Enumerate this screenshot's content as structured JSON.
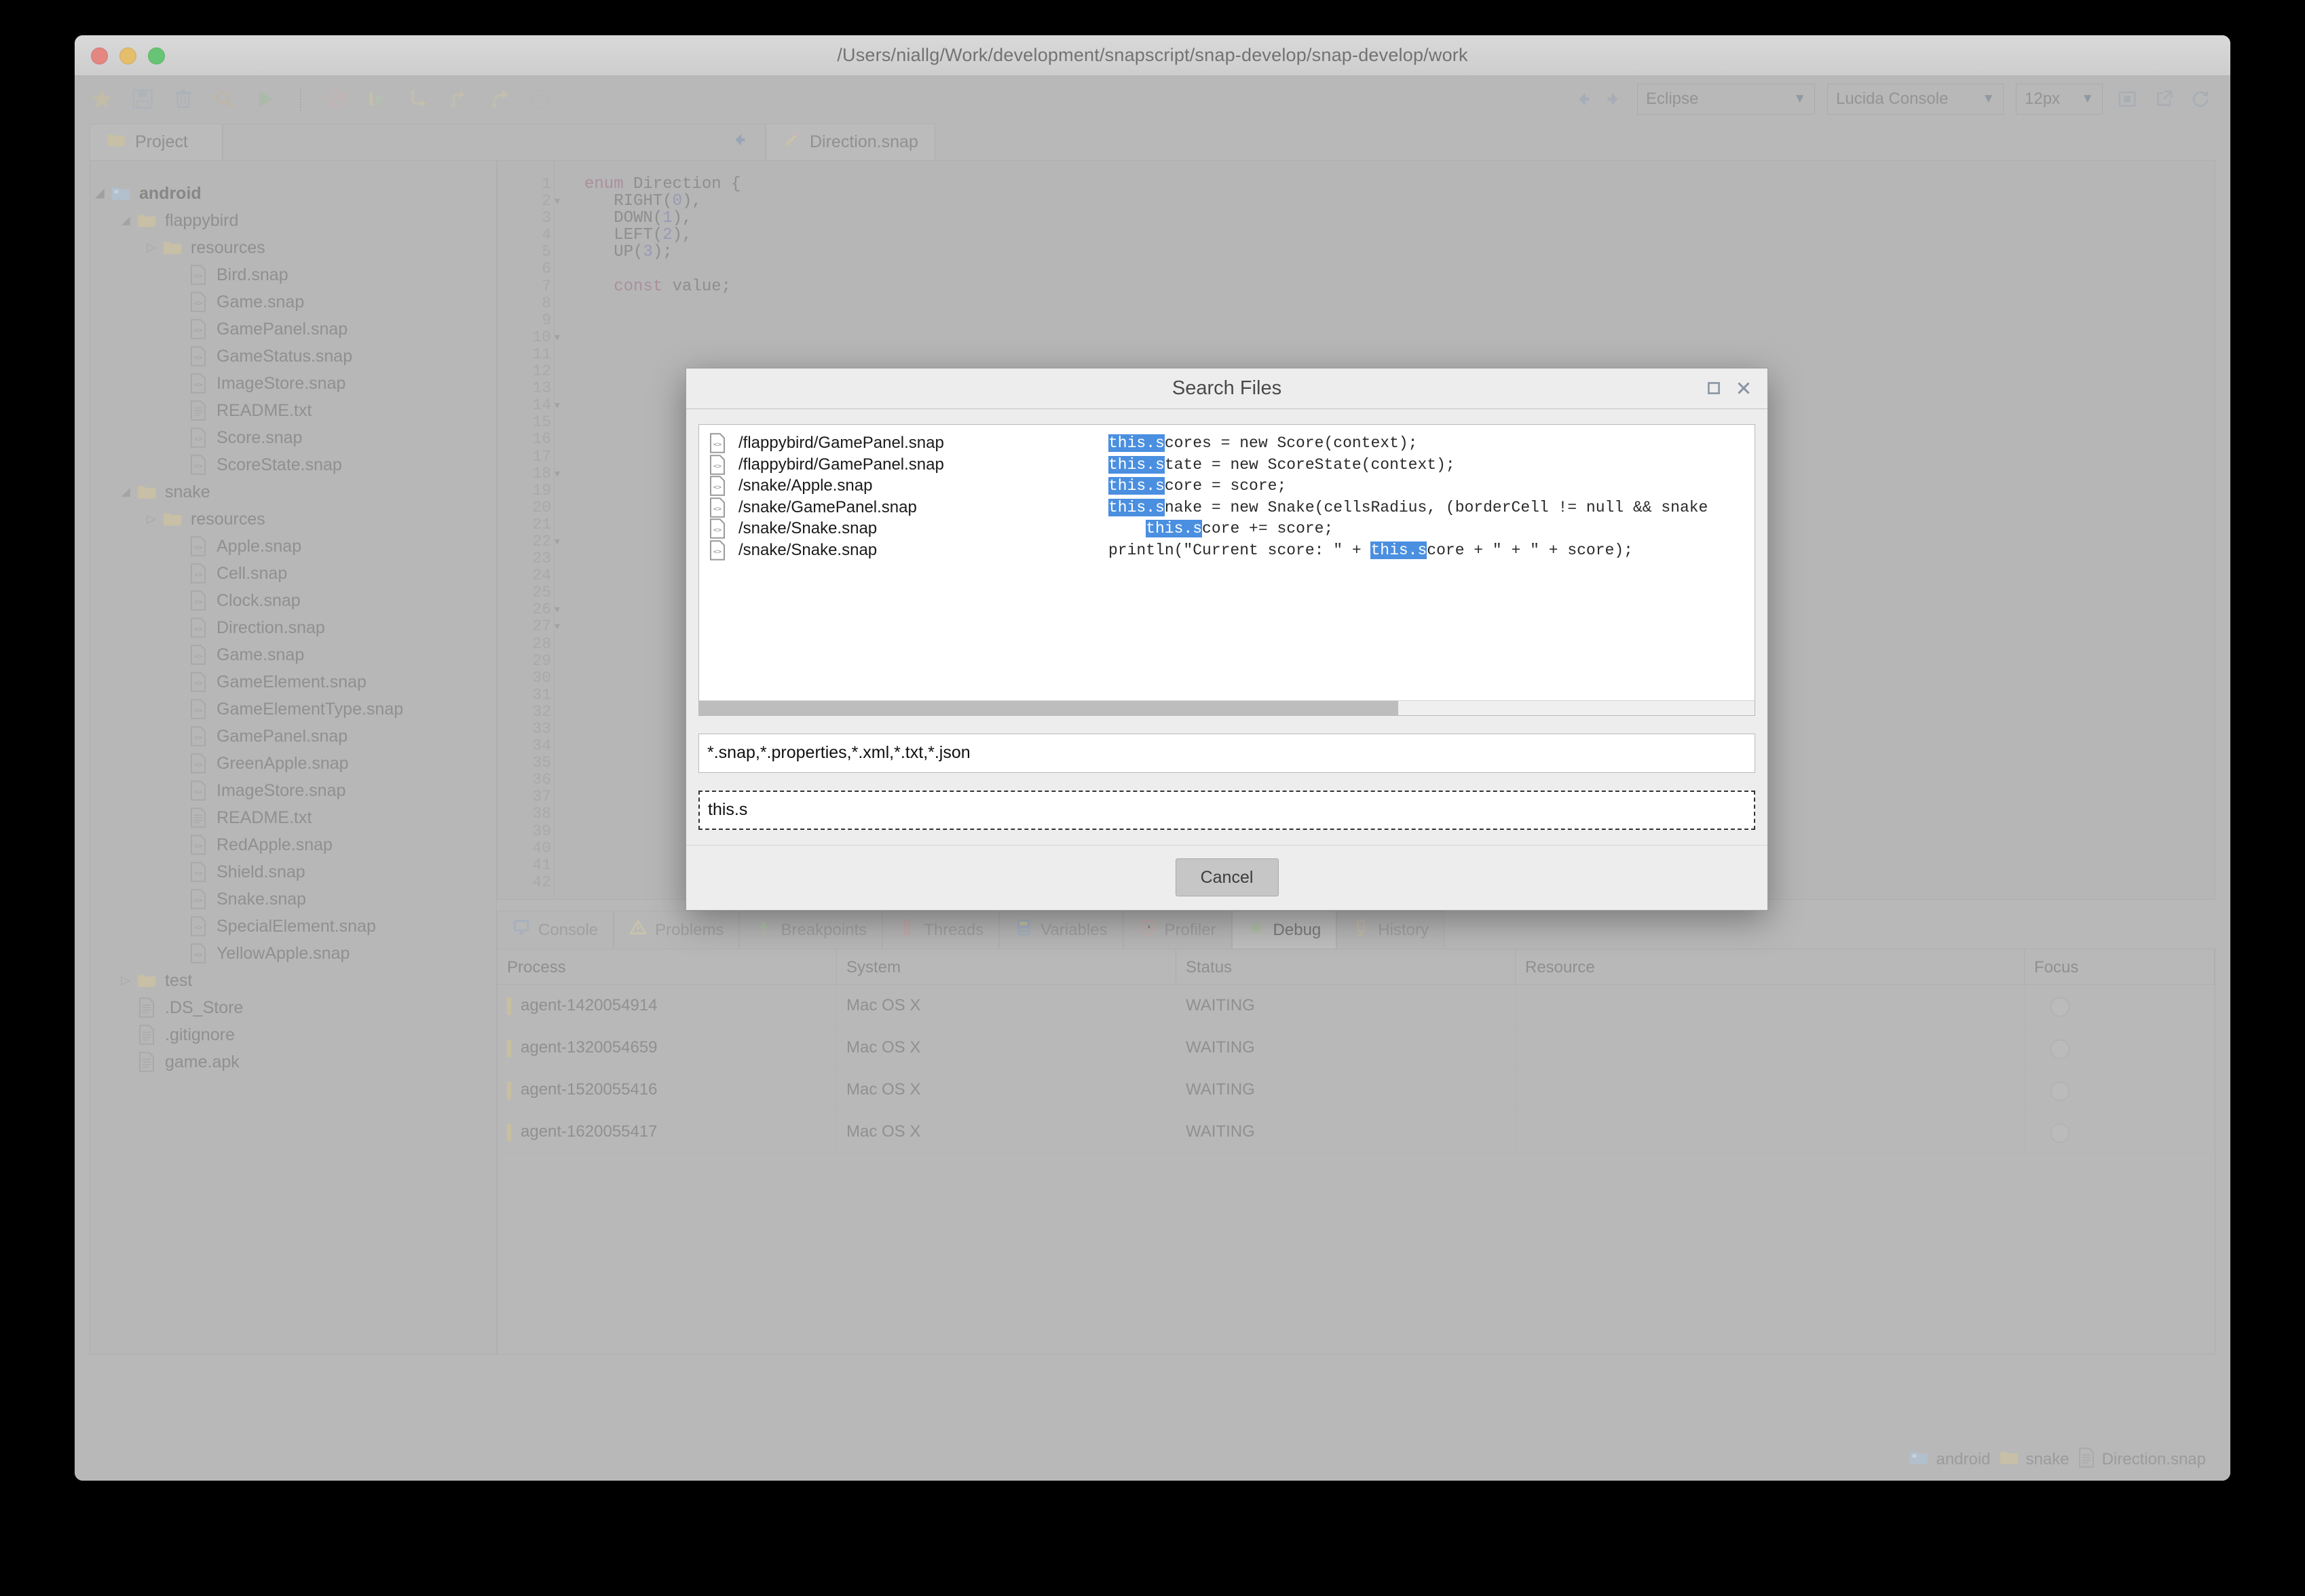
{
  "window": {
    "title": "/Users/niallg/Work/development/snapscript/snap-develop/snap-develop/work"
  },
  "toolbar": {
    "icons": [
      {
        "name": "favorite-icon",
        "glyph": "★"
      },
      {
        "name": "save-icon",
        "glyph": "💾"
      },
      {
        "name": "delete-icon",
        "glyph": "🗑"
      },
      {
        "name": "search-icon",
        "glyph": "🔍"
      },
      {
        "name": "run-icon",
        "glyph": "▶"
      },
      {
        "name": "stop-icon",
        "glyph": "⊘"
      },
      {
        "name": "step-over-icon",
        "glyph": "▯▶"
      },
      {
        "name": "step-into-icon",
        "glyph": "↴"
      },
      {
        "name": "step-out-icon",
        "glyph": "↥"
      },
      {
        "name": "step-return-icon",
        "glyph": "↪"
      },
      {
        "name": "help-icon",
        "glyph": "?"
      }
    ],
    "theme": "Eclipse",
    "font": "Lucida Console",
    "size": "12px",
    "back_arrow": "◀",
    "forward_arrow": "▶",
    "dropdown_arrow": "▼"
  },
  "tabs": {
    "project_label": "Project",
    "editor_label": "Direction.snap"
  },
  "tree": [
    {
      "label": "android",
      "depth": 0,
      "icon": "folder-blue",
      "twisty": "open",
      "bold": true
    },
    {
      "label": "flappybird",
      "depth": 1,
      "icon": "folder-tan",
      "twisty": "open"
    },
    {
      "label": "resources",
      "depth": 2,
      "icon": "folder-tan",
      "twisty": "closed"
    },
    {
      "label": "Bird.snap",
      "depth": 3,
      "icon": "file-code"
    },
    {
      "label": "Game.snap",
      "depth": 3,
      "icon": "file-code"
    },
    {
      "label": "GamePanel.snap",
      "depth": 3,
      "icon": "file-code"
    },
    {
      "label": "GameStatus.snap",
      "depth": 3,
      "icon": "file-code"
    },
    {
      "label": "ImageStore.snap",
      "depth": 3,
      "icon": "file-code"
    },
    {
      "label": "README.txt",
      "depth": 3,
      "icon": "file-plain"
    },
    {
      "label": "Score.snap",
      "depth": 3,
      "icon": "file-code"
    },
    {
      "label": "ScoreState.snap",
      "depth": 3,
      "icon": "file-code"
    },
    {
      "label": "snake",
      "depth": 1,
      "icon": "folder-tan",
      "twisty": "open"
    },
    {
      "label": "resources",
      "depth": 2,
      "icon": "folder-tan",
      "twisty": "closed"
    },
    {
      "label": "Apple.snap",
      "depth": 3,
      "icon": "file-code"
    },
    {
      "label": "Cell.snap",
      "depth": 3,
      "icon": "file-code"
    },
    {
      "label": "Clock.snap",
      "depth": 3,
      "icon": "file-code"
    },
    {
      "label": "Direction.snap",
      "depth": 3,
      "icon": "file-code"
    },
    {
      "label": "Game.snap",
      "depth": 3,
      "icon": "file-code"
    },
    {
      "label": "GameElement.snap",
      "depth": 3,
      "icon": "file-code"
    },
    {
      "label": "GameElementType.snap",
      "depth": 3,
      "icon": "file-code"
    },
    {
      "label": "GamePanel.snap",
      "depth": 3,
      "icon": "file-code"
    },
    {
      "label": "GreenApple.snap",
      "depth": 3,
      "icon": "file-code"
    },
    {
      "label": "ImageStore.snap",
      "depth": 3,
      "icon": "file-code"
    },
    {
      "label": "README.txt",
      "depth": 3,
      "icon": "file-plain"
    },
    {
      "label": "RedApple.snap",
      "depth": 3,
      "icon": "file-code"
    },
    {
      "label": "Shield.snap",
      "depth": 3,
      "icon": "file-code"
    },
    {
      "label": "Snake.snap",
      "depth": 3,
      "icon": "file-code"
    },
    {
      "label": "SpecialElement.snap",
      "depth": 3,
      "icon": "file-code"
    },
    {
      "label": "YellowApple.snap",
      "depth": 3,
      "icon": "file-code"
    },
    {
      "label": "test",
      "depth": 1,
      "icon": "folder-tan",
      "twisty": "closed"
    },
    {
      "label": ".DS_Store",
      "depth": 1,
      "icon": "file-plain"
    },
    {
      "label": ".gitignore",
      "depth": 1,
      "icon": "file-plain"
    },
    {
      "label": "game.apk",
      "depth": 1,
      "icon": "file-plain"
    }
  ],
  "editor": {
    "first_line": 1,
    "last_line": 42,
    "fold_lines": [
      2,
      10,
      14,
      18,
      22,
      26,
      27
    ],
    "lines": [
      {
        "n": 1,
        "text": ""
      },
      {
        "n": 2,
        "text": "enum Direction {"
      },
      {
        "n": 3,
        "text": "   RIGHT(0),"
      },
      {
        "n": 4,
        "text": "   DOWN(1),"
      },
      {
        "n": 5,
        "text": "   LEFT(2),"
      },
      {
        "n": 6,
        "text": "   UP(3);"
      },
      {
        "n": 7,
        "text": ""
      },
      {
        "n": 8,
        "text": "   const value;"
      },
      {
        "n": 9,
        "text": ""
      },
      {
        "n": 40,
        "text": "}"
      }
    ]
  },
  "dialog": {
    "title": "Search Files",
    "maximize_glyph": "☐",
    "close_glyph": "✕",
    "results": [
      {
        "path": "/flappybird/GamePanel.snap",
        "indent": 0,
        "pre": "",
        "match": "this.s",
        "post": "cores = new Score(context);"
      },
      {
        "path": "/flappybird/GamePanel.snap",
        "indent": 0,
        "pre": "",
        "match": "this.s",
        "post": "tate = new ScoreState(context);"
      },
      {
        "path": "/snake/Apple.snap",
        "indent": 0,
        "pre": "",
        "match": "this.s",
        "post": "core = score;"
      },
      {
        "path": "/snake/GamePanel.snap",
        "indent": 0,
        "pre": "",
        "match": "this.s",
        "post": "nake = new Snake(cellsRadius, (borderCell != null && snake"
      },
      {
        "path": "/snake/Snake.snap",
        "indent": 2,
        "pre": "",
        "match": "this.s",
        "post": "core += score;"
      },
      {
        "path": "/snake/Snake.snap",
        "indent": 0,
        "pre": "println(\"Current score: \" + ",
        "match": "this.s",
        "post": "core + \" + \" + score);"
      }
    ],
    "filter_value": "*.snap,*.properties,*.xml,*.txt,*.json",
    "search_value": "this.s",
    "cancel_label": "Cancel"
  },
  "bottom_tabs": [
    {
      "label": "Console",
      "icon": "console-icon",
      "active": false
    },
    {
      "label": "Problems",
      "icon": "warning-icon",
      "active": false
    },
    {
      "label": "Breakpoints",
      "icon": "breakpoint-icon",
      "active": false
    },
    {
      "label": "Threads",
      "icon": "threads-icon",
      "active": false
    },
    {
      "label": "Variables",
      "icon": "variables-icon",
      "active": false
    },
    {
      "label": "Profiler",
      "icon": "profiler-icon",
      "active": false
    },
    {
      "label": "Debug",
      "icon": "debug-icon",
      "active": true
    },
    {
      "label": "History",
      "icon": "history-icon",
      "active": false
    }
  ],
  "debug_table": {
    "columns": [
      "Process",
      "System",
      "Status",
      "Resource",
      "Focus"
    ],
    "rows": [
      {
        "process": "agent-1420054914",
        "system": "Mac OS X",
        "status": "WAITING",
        "resource": "",
        "focus": ""
      },
      {
        "process": "agent-1320054659",
        "system": "Mac OS X",
        "status": "WAITING",
        "resource": "",
        "focus": ""
      },
      {
        "process": "agent-1520055416",
        "system": "Mac OS X",
        "status": "WAITING",
        "resource": "",
        "focus": ""
      },
      {
        "process": "agent-1620055417",
        "system": "Mac OS X",
        "status": "WAITING",
        "resource": "",
        "focus": ""
      }
    ]
  },
  "statusbar": [
    {
      "label": "android",
      "icon": "folder-blue-icon"
    },
    {
      "label": "snake",
      "icon": "folder-tan-icon"
    },
    {
      "label": "Direction.snap",
      "icon": "file-icon"
    }
  ],
  "colors": {
    "highlight": "#4a8fe0",
    "window_bg": "#b4b4b4",
    "dialog_bg": "#ededed"
  }
}
